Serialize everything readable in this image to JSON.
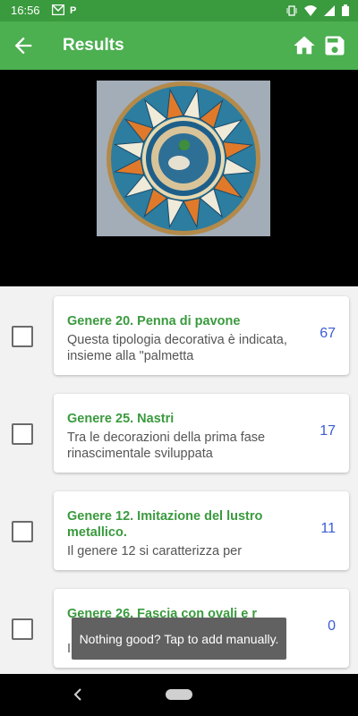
{
  "status_bar": {
    "time": "16:56",
    "left_icons": [
      "gmail-icon",
      "parking-icon"
    ],
    "right_icons": [
      "vibrate-icon",
      "wifi-icon",
      "signal-icon",
      "battery-icon"
    ]
  },
  "app_bar": {
    "title": "Results",
    "color": "#4caf50",
    "icons": [
      "arrow-back-icon",
      "home-icon",
      "save-icon"
    ]
  },
  "results": [
    {
      "title": "Genere 20. Penna di pavone",
      "description": "Questa tipologia decorativa è indicata, insieme alla \"palmetta",
      "count": "67"
    },
    {
      "title": "Genere 25. Nastri",
      "description": "Tra le decorazioni della prima fase rinascimentale sviluppata",
      "count": "17"
    },
    {
      "title": "Genere 12. Imitazione del lustro metallico.",
      "description": "Il genere 12 si caratterizza per",
      "count": "11"
    },
    {
      "title": "Genere 26. Fascia con ovali e r",
      "description": "Il",
      "count": "0"
    }
  ],
  "toast": {
    "text": "Nothing good? Tap to add manually."
  },
  "colors": {
    "accent": "#4caf50",
    "title_green": "#3a9a3e",
    "count_blue": "#3b5bd6"
  }
}
